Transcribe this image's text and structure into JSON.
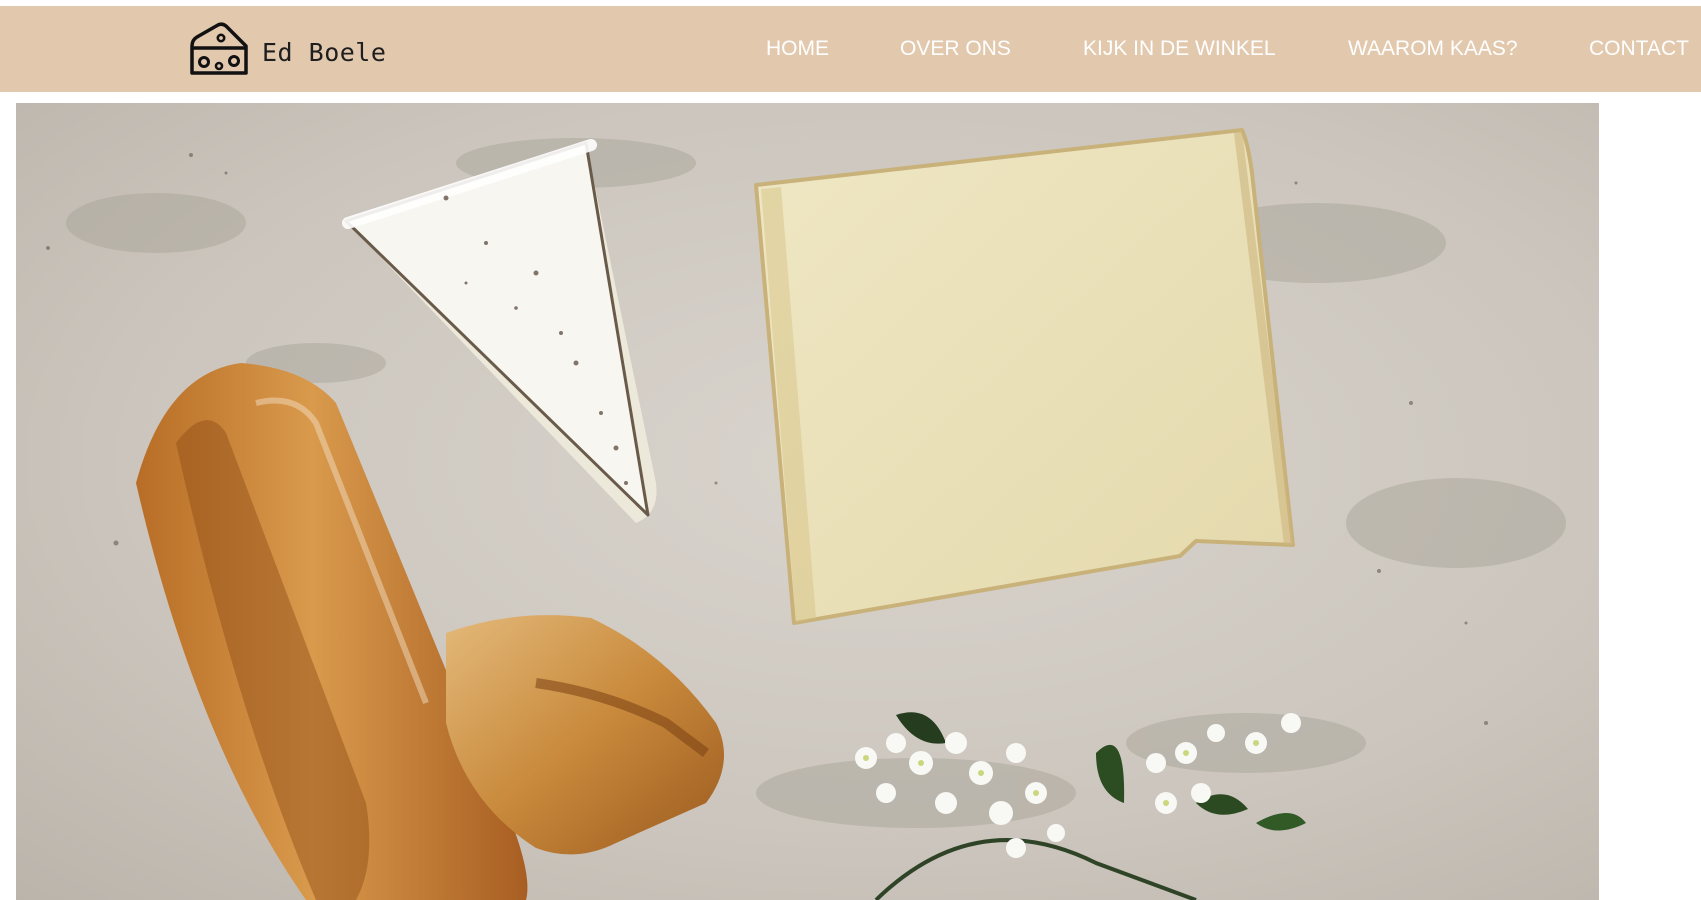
{
  "brand": {
    "name": "Ed Boele",
    "icon": "cheese-logo-icon"
  },
  "nav": {
    "items": [
      {
        "label": "HOME"
      },
      {
        "label": "OVER ONS"
      },
      {
        "label": "KIJK IN DE WINKEL"
      },
      {
        "label": "WAAROM KAAS?"
      },
      {
        "label": "CONTACT"
      }
    ]
  },
  "hero": {
    "image": "cheese-bread-flowers-photo"
  },
  "colors": {
    "header_background": "#e2c9ae",
    "nav_text": "#ffffff",
    "brand_text": "#1e1e1e"
  }
}
